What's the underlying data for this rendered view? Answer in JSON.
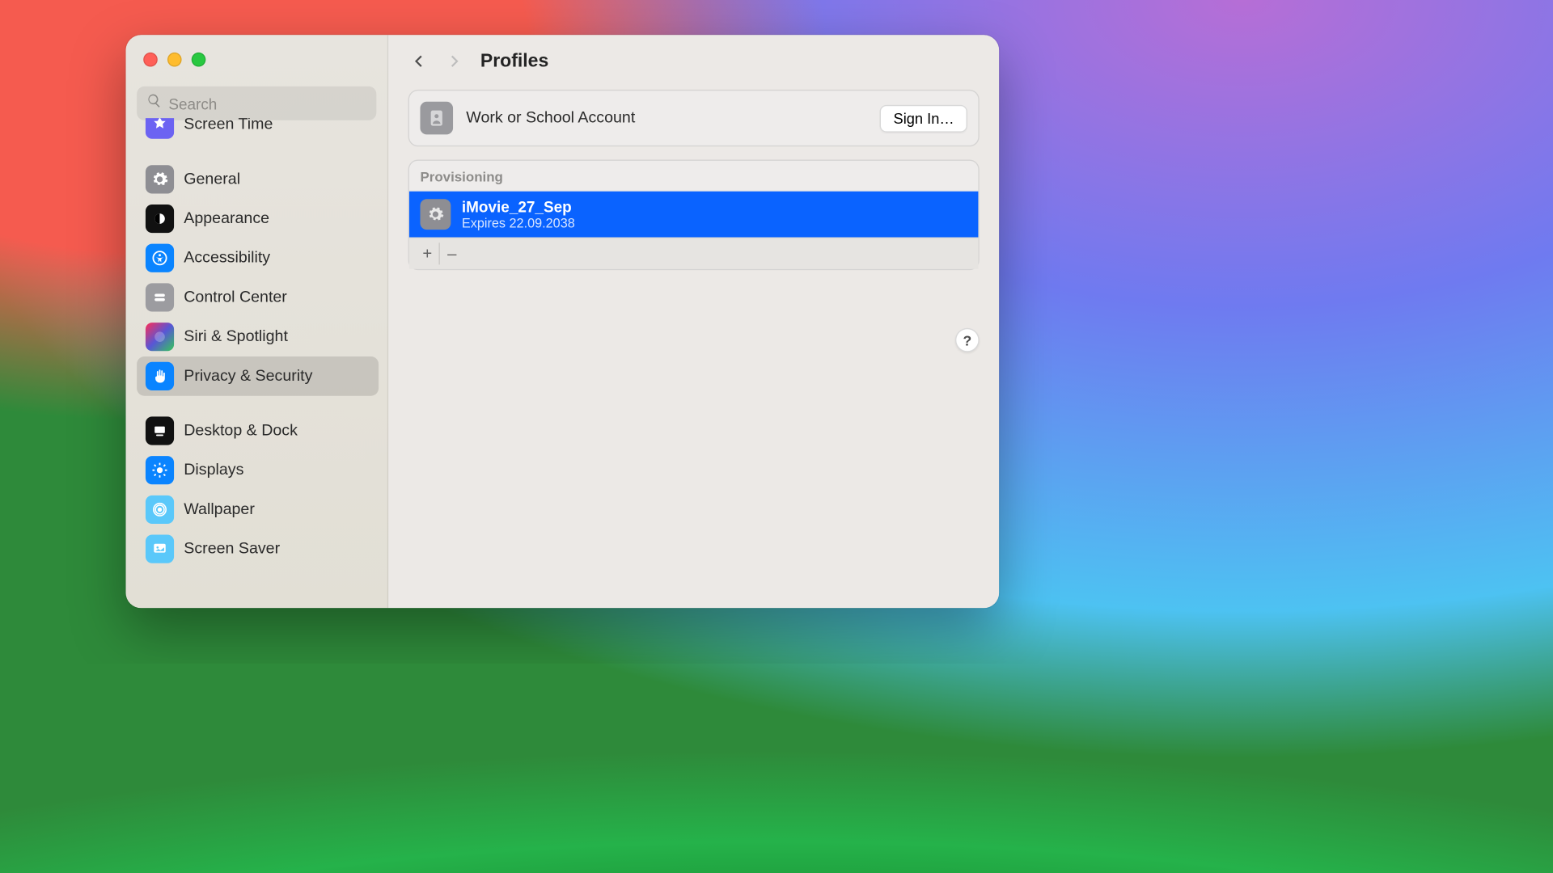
{
  "header": {
    "title": "Profiles"
  },
  "search": {
    "placeholder": "Search"
  },
  "sidebar": {
    "items": {
      "screen_time": "Screen Time",
      "general": "General",
      "appearance": "Appearance",
      "accessibility": "Accessibility",
      "control_center": "Control Center",
      "siri": "Siri & Spotlight",
      "privacy": "Privacy & Security",
      "desktop": "Desktop & Dock",
      "displays": "Displays",
      "wallpaper": "Wallpaper",
      "screensaver": "Screen Saver"
    }
  },
  "account": {
    "title": "Work or School Account",
    "signin": "Sign In…"
  },
  "provisioning": {
    "header": "Provisioning",
    "profile": {
      "name": "iMovie_27_Sep",
      "expires": "Expires 22.09.2038"
    },
    "add": "+",
    "remove": "–"
  },
  "help": "?"
}
